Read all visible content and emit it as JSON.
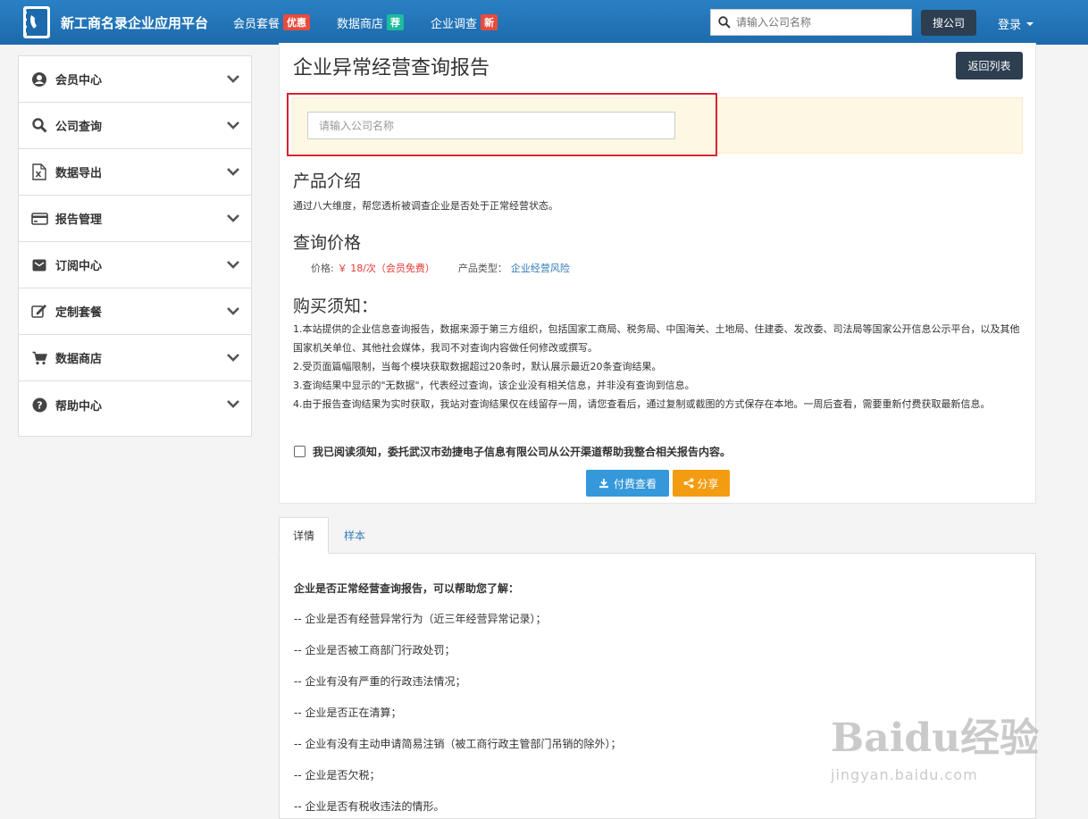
{
  "header": {
    "site_title": "新工商名录企业应用平台",
    "nav": [
      {
        "label": "会员套餐",
        "badge": "优惠",
        "badge_color": "#e74c3c"
      },
      {
        "label": "数据商店",
        "badge": "荐",
        "badge_color": "#1abc9c"
      },
      {
        "label": "企业调查",
        "badge": "新",
        "badge_color": "#e74c3c"
      }
    ],
    "search_placeholder": "请输入公司名称",
    "search_button": "搜公司",
    "login": "登录"
  },
  "sidebar": {
    "items": [
      {
        "label": "会员中心",
        "icon": "user-circle-icon"
      },
      {
        "label": "公司查询",
        "icon": "search-icon"
      },
      {
        "label": "数据导出",
        "icon": "excel-file-icon"
      },
      {
        "label": "报告管理",
        "icon": "credit-card-icon"
      },
      {
        "label": "订阅中心",
        "icon": "envelope-icon"
      },
      {
        "label": "定制套餐",
        "icon": "edit-icon"
      },
      {
        "label": "数据商店",
        "icon": "cart-icon"
      },
      {
        "label": "帮助中心",
        "icon": "question-circle-icon"
      }
    ]
  },
  "main": {
    "title": "企业异常经营查询报告",
    "back_button": "返回列表",
    "company_input_placeholder": "请输入公司名称",
    "intro_heading": "产品介绍",
    "intro_text": "通过八大维度，帮您透析被调查企业是否处于正常经营状态。",
    "price_heading": "查询价格",
    "price_label": "价格:",
    "price_value": "￥ 18/次（会员免费）",
    "type_label": "产品类型：",
    "type_value": "企业经营风险",
    "notice_heading": "购买须知：",
    "notices": [
      "1.本站提供的企业信息查询报告，数据来源于第三方组织，包括国家工商局、税务局、中国海关、土地局、住建委、发改委、司法局等国家公开信息公示平台，以及其他国家机关单位、其他社会媒体，我司不对查询内容做任何修改或撰写。",
      "2.受页面篇幅限制，当每个模块获取数据超过20条时，默认展示最近20条查询结果。",
      "3.查询结果中显示的\"无数据\"，代表经过查询，该企业没有相关信息，并非没有查询到信息。",
      "4.由于报告查询结果为实时获取，我站对查询结果仅在线留存一周，请您查看后，通过复制或截图的方式保存在本地。一周后查看，需要重新付费获取最新信息。"
    ],
    "agree_text": "我已阅读须知，委托武汉市劲捷电子信息有限公司从公开渠道帮助我整合相关报告内容。",
    "pay_button": "付费查看",
    "share_button": "分享"
  },
  "tabs": {
    "detail": "详情",
    "sample": "样本"
  },
  "detail": {
    "heading": "企业是否正常经营查询报告，可以帮助您了解：",
    "lines": [
      "-- 企业是否有经营异常行为（近三年经营异常记录）；",
      "-- 企业是否被工商部门行政处罚；",
      "-- 企业有没有严重的行政违法情况；",
      "-- 企业是否正在清算；",
      "-- 企业有没有主动申请简易注销（被工商行政主管部门吊销的除外）；",
      "-- 企业是否欠税；",
      "-- 企业是否有税收违法的情形。"
    ]
  },
  "watermark": {
    "big": "Baidu经验",
    "small": "jingyan.baidu.com"
  }
}
